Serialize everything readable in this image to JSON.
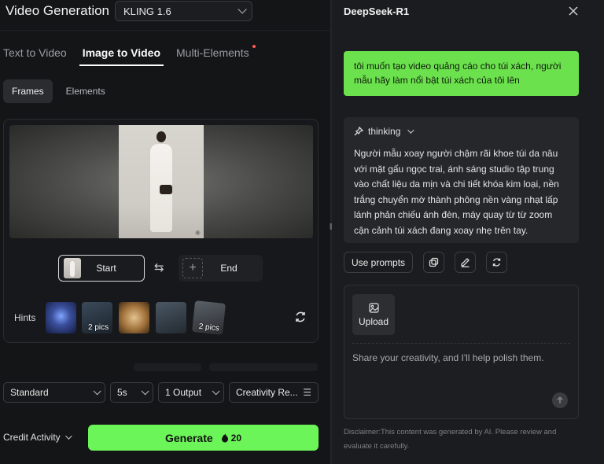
{
  "left": {
    "title": "Video Generation",
    "model": "KLING 1.6",
    "tabs": [
      "Text to Video",
      "Image to Video",
      "Multi-Elements"
    ],
    "active_tab": "Image to Video",
    "sub_tabs": [
      "Frames",
      "Elements"
    ],
    "frames": {
      "start_label": "Start",
      "end_label": "End",
      "plus": "+"
    },
    "hints": {
      "label": "Hints",
      "items": [
        {
          "count": ""
        },
        {
          "count": "2 pics"
        },
        {
          "count": ""
        },
        {
          "count": ""
        },
        {
          "count": "2 pics"
        }
      ]
    },
    "options": {
      "mode": "Standard",
      "duration": "5s",
      "outputs": "1 Output",
      "creativity": "Creativity Re..."
    },
    "credit_label": "Credit Activity",
    "generate": {
      "label": "Generate",
      "cost": "20"
    }
  },
  "right": {
    "title": "DeepSeek-R1",
    "user_message": "tôi muốn tạo video quảng cáo cho túi xách, người mẫu hãy làm nổi bật túi xách của tôi lên",
    "thinking_label": "thinking",
    "thinking_text": "Người mẫu xoay người chậm rãi khoe túi da nâu với mặt gấu ngọc trai, ánh sáng studio tập trung vào chất liệu da mịn và chi tiết khóa kim loại, nền trắng chuyển mờ thành phông nền vàng nhạt lấp lánh phản chiếu ánh đèn, máy quay từ từ zoom cận cảnh túi xách đang xoay nhẹ trên tay.",
    "use_prompts": "Use prompts",
    "upload_label": "Upload",
    "composer_placeholder": "Share your creativity, and I'll help polish them.",
    "disclaimer": "Disclaimer:This content was generated by AI. Please review and evaluate it carefully."
  },
  "colors": {
    "accent": "#6cf559",
    "user_bubble": "#6ce14e",
    "background": "#141517"
  }
}
